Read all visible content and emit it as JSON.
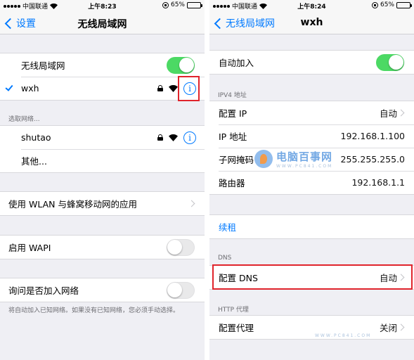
{
  "colors": {
    "accent": "#007aff",
    "toggle_on": "#4cd964",
    "highlight": "#e0242c",
    "background": "#efeff4"
  },
  "left_screen": {
    "status": {
      "carrier": "中国联通",
      "time": "上午8:23",
      "battery": "65%",
      "battery_level": 0.65
    },
    "nav": {
      "back_label": "设置",
      "title": "无线局域网"
    },
    "wifi_toggle": {
      "label": "无线局域网",
      "on": true
    },
    "connected_network": {
      "name": "wxh",
      "selected": true,
      "icons": [
        "lock-icon",
        "wifi-icon",
        "info-icon"
      ]
    },
    "choose_network_label": "选取网络...",
    "networks": [
      {
        "name": "shutao",
        "icons": [
          "lock-icon",
          "wifi-icon",
          "info-icon"
        ]
      },
      {
        "name": "其他..."
      }
    ],
    "wlan_apps": {
      "label": "使用 WLAN 与蜂窝移动网的应用"
    },
    "wapi": {
      "label": "启用 WAPI",
      "on": false
    },
    "ask_join": {
      "label": "询问是否加入网络",
      "on": false
    },
    "ask_join_footer": "将自动加入已知网络。如果没有已知网络，您必须手动选择。"
  },
  "right_screen": {
    "status": {
      "carrier": "中国联通",
      "time": "上午8:24",
      "battery": "65%",
      "battery_level": 0.65
    },
    "nav": {
      "back_label": "无线局域网",
      "title": "wxh"
    },
    "auto_join": {
      "label": "自动加入",
      "on": true
    },
    "ipv4_label": "IPV4 地址",
    "ipv4_rows": [
      {
        "label": "配置 IP",
        "value": "自动",
        "chevron": true
      },
      {
        "label": "IP 地址",
        "value": "192.168.1.100"
      },
      {
        "label": "子网掩码",
        "value": "255.255.255.0"
      },
      {
        "label": "路由器",
        "value": "192.168.1.1"
      }
    ],
    "renew_lease": "续租",
    "dns_label": "DNS",
    "dns_row": {
      "label": "配置 DNS",
      "value": "自动"
    },
    "http_proxy_label": "HTTP 代理",
    "proxy_row": {
      "label": "配置代理",
      "value": "关闭"
    }
  },
  "watermark": {
    "title": "电脑百事网",
    "url": "WWW.PC841.COM"
  }
}
